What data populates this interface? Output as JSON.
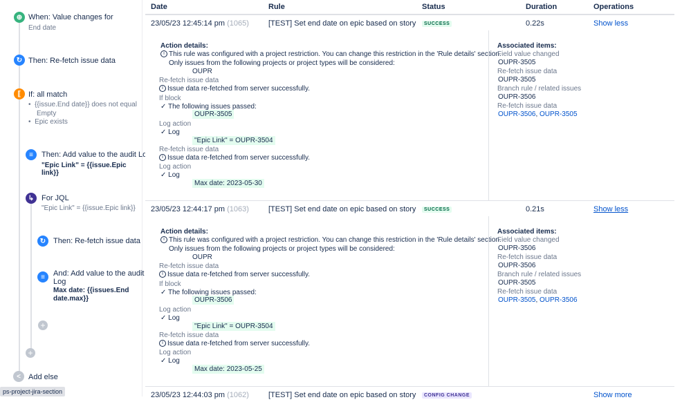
{
  "sidebar": {
    "trigger_title": "When: Value changes for",
    "trigger_sub": "End date",
    "refetch1": "Then: Re-fetch issue data",
    "if_title": "If: all match",
    "cond1a": "{{issue.End date}} does not equal",
    "cond1b": "Empty",
    "cond2": "Epic exists",
    "audit1_title": "Then: Add value to the audit Log",
    "audit1_value": "\"Epic Link\" = {{issue.Epic link}}",
    "forjql_title": "For JQL",
    "forjql_sub": "\"Epic Link\" = {{issue.Epic link}}",
    "refetch2": "Then: Re-fetch issue data",
    "audit2_title_a": "And: Add value to the audit",
    "audit2_title_b": "Log",
    "audit2_value_a": "Max date: {{issues.End",
    "audit2_value_b": "date.max}}",
    "add_else": "Add else",
    "tooltip": "ps-project-jira-section",
    "colors": {
      "trigger": "#36b37e",
      "action": "#2684ff",
      "condition": "#ff8b00",
      "branch": "#6554c0"
    }
  },
  "table": {
    "headers": {
      "date": "Date",
      "rule": "Rule",
      "status": "Status",
      "duration": "Duration",
      "operations": "Operations"
    },
    "rows": [
      {
        "date": "23/05/23 12:45:14 pm",
        "id": "(1065)",
        "rule": "[TEST] Set end date on epic based on story",
        "status": "SUCCESS",
        "duration": "0.22s",
        "op": "Show less"
      },
      {
        "date": "23/05/23 12:44:17 pm",
        "id": "(1063)",
        "rule": "[TEST] Set end date on epic based on story",
        "status": "SUCCESS",
        "duration": "0.21s",
        "op": "Show less"
      },
      {
        "date": "23/05/23 12:44:03 pm",
        "id": "(1062)",
        "rule": "[TEST] Set end date on epic based on story",
        "status": "CONFIG CHANGE",
        "duration": "",
        "op": "Show more"
      }
    ]
  },
  "details": [
    {
      "action_details": "Action details:",
      "restriction1": "This rule was configured with a project restriction. You can change this restriction in the 'Rule details' section.",
      "restriction2": "Only issues from the following projects or project types will be considered:",
      "project": "OUPR",
      "refetch_label": "Re-fetch issue data",
      "refetch_msg": "Issue data re-fetched from server successfully.",
      "if_block": "If block",
      "passed": "The following issues passed:",
      "passed_issue": "OUPR-3505",
      "log_action": "Log action",
      "log": "Log",
      "log_value": "\"Epic Link\" = OUPR-3504",
      "refetch2_label": "Re-fetch issue data",
      "refetch2_msg": "Issue data re-fetched from server successfully.",
      "log_action2": "Log action",
      "log2": "Log",
      "log2_value": "Max date: 2023-05-30",
      "assoc": {
        "title": "Associated items:",
        "g1": "Field value changed",
        "g1v": "OUPR-3505",
        "g2": "Re-fetch issue data",
        "g2v": "OUPR-3505",
        "g3": "Branch rule / related issues",
        "g3v": "OUPR-3506",
        "g4": "Re-fetch issue data",
        "g4v1": "OUPR-3506",
        "g4v2": "OUPR-3505"
      }
    },
    {
      "action_details": "Action details:",
      "restriction1": "This rule was configured with a project restriction. You can change this restriction in the 'Rule details' section.",
      "restriction2": "Only issues from the following projects or project types will be considered:",
      "project": "OUPR",
      "refetch_label": "Re-fetch issue data",
      "refetch_msg": "Issue data re-fetched from server successfully.",
      "if_block": "If block",
      "passed": "The following issues passed:",
      "passed_issue": "OUPR-3506",
      "log_action": "Log action",
      "log": "Log",
      "log_value": "\"Epic Link\" = OUPR-3504",
      "refetch2_label": "Re-fetch issue data",
      "refetch2_msg": "Issue data re-fetched from server successfully.",
      "log_action2": "Log action",
      "log2": "Log",
      "log2_value": "Max date: 2023-05-25",
      "assoc": {
        "title": "Associated items:",
        "g1": "Field value changed",
        "g1v": "OUPR-3506",
        "g2": "Re-fetch issue data",
        "g2v": "OUPR-3506",
        "g3": "Branch rule / related issues",
        "g3v": "OUPR-3505",
        "g4": "Re-fetch issue data",
        "g4v1": "OUPR-3505",
        "g4v2": "OUPR-3506"
      }
    }
  ]
}
